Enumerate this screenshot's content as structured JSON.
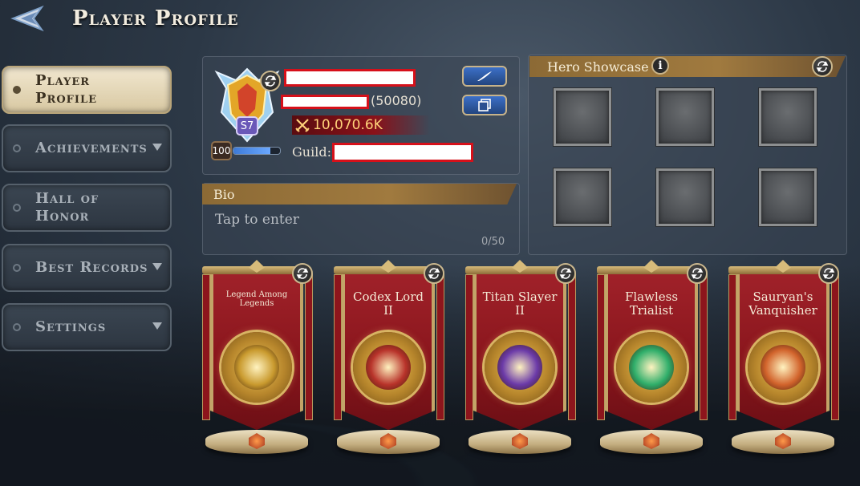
{
  "header": {
    "title": "Player Profile"
  },
  "sidebar": {
    "items": [
      {
        "label": "Player Profile",
        "active": true,
        "has_dropdown": false
      },
      {
        "label": "Achievements",
        "active": false,
        "has_dropdown": true
      },
      {
        "label": "Hall of Honor",
        "active": false,
        "has_dropdown": false
      },
      {
        "label": "Best Records",
        "active": false,
        "has_dropdown": true
      },
      {
        "label": "Settings",
        "active": false,
        "has_dropdown": true
      }
    ]
  },
  "profile": {
    "season_badge": "S7",
    "rating": "(50080)",
    "power": "10,070.6K",
    "level": "100",
    "xp_fraction": 0.8,
    "guild_label": "Guild:",
    "redacted_color": "#d6101a"
  },
  "bio": {
    "header": "Bio",
    "placeholder": "Tap to enter",
    "count": "0/50"
  },
  "showcase": {
    "header": "Hero Showcase",
    "info_icon": "i",
    "slot_count": 6
  },
  "medals": [
    {
      "title": "Legend Among Legends",
      "small": true,
      "core_color": "#c99a2e"
    },
    {
      "title": "Codex Lord II",
      "small": false,
      "core_color": "#b8332a"
    },
    {
      "title": "Titan Slayer II",
      "small": false,
      "core_color": "#6b3aa8"
    },
    {
      "title": "Flawless Trialist",
      "small": false,
      "core_color": "#2fae6a"
    },
    {
      "title": "Sauryan's Vanquisher",
      "small": false,
      "core_color": "#d2642c"
    }
  ],
  "colors": {
    "accent_gold": "#c3a468",
    "banner_red": "#8a161d",
    "button_blue": "#3c70c8",
    "power_red": "#8a1119"
  }
}
